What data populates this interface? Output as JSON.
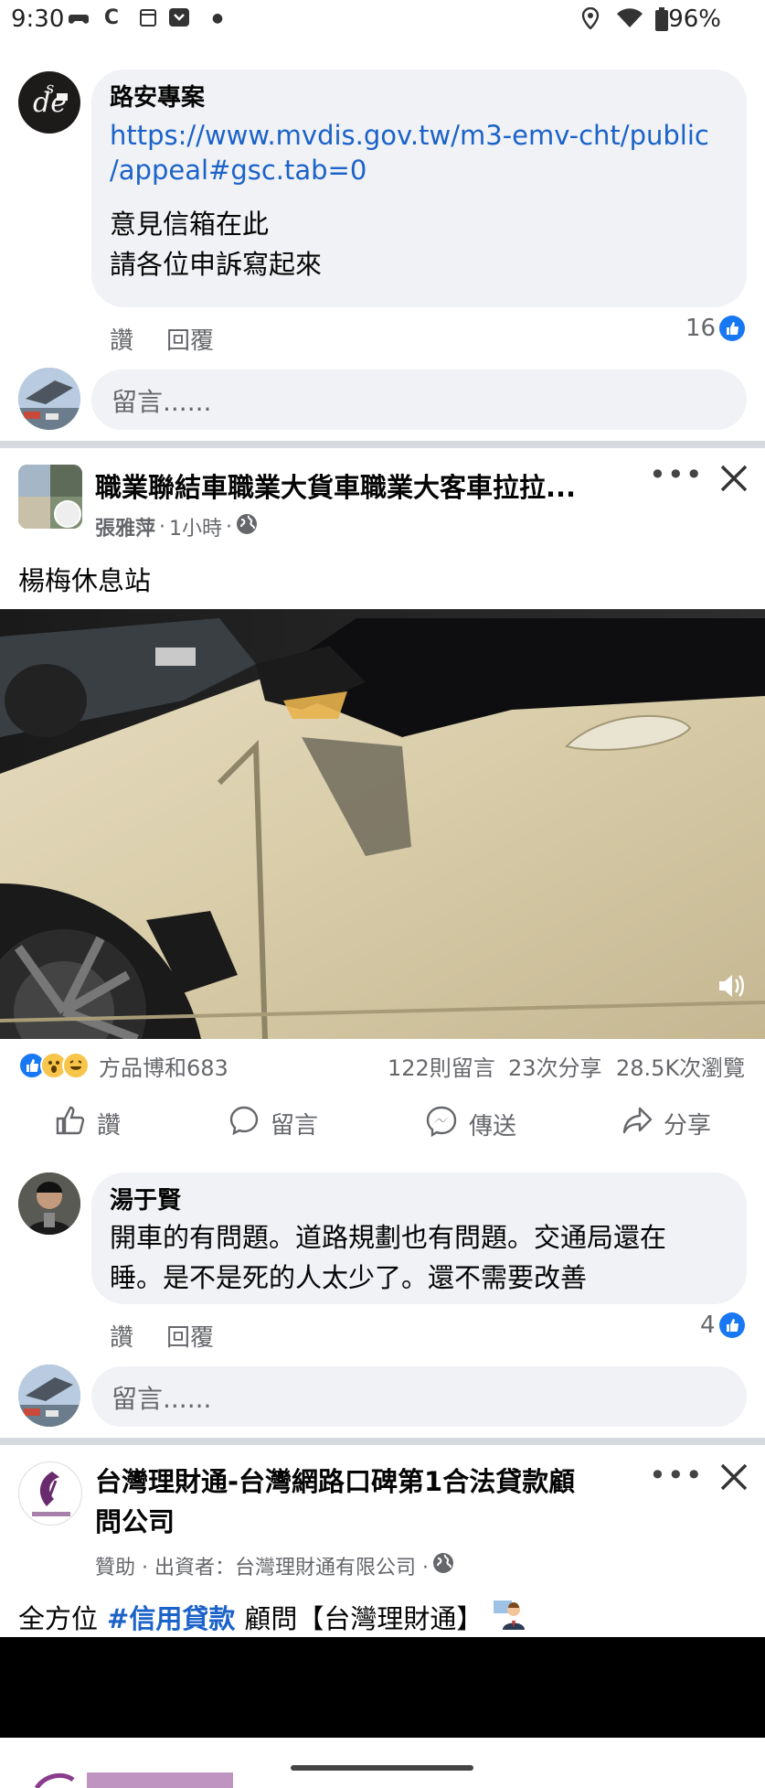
{
  "status_bar": {
    "time": "9:30",
    "battery": "96%"
  },
  "comment1": {
    "author": "路安專案",
    "link": "https://www.mvdis.gov.tw/m3-emv-cht/public/appeal#gsc.tab=0",
    "link_line1": "https://www.mvdis.gov.tw/m3-emv-cht/public",
    "link_line2": "/appeal#gsc.tab=0",
    "line1": "意見信箱在此",
    "line2": "請各位申訴寫起來",
    "like_label": "讚",
    "reply_label": "回覆",
    "like_count": "16"
  },
  "comment_input1": {
    "placeholder": "留言......"
  },
  "post1": {
    "page_name": "職業聯結車職業大貨車職業大客車拉拉...",
    "author": "張雅萍",
    "time": "1小時",
    "text": "楊梅休息站",
    "reactors": "方品博和683",
    "comments": "122則留言",
    "shares": "23次分享",
    "views": "28.5K次瀏覽",
    "buttons": {
      "like": "讚",
      "comment": "留言",
      "send": "傳送",
      "share": "分享"
    }
  },
  "comment2": {
    "author": "湯于賢",
    "line1": "開車的有問題。道路規劃也有問題。交通局還在",
    "line2": "睡。是不是死的人太少了。還不需要改善",
    "like_label": "讚",
    "reply_label": "回覆",
    "like_count": "4"
  },
  "comment_input2": {
    "placeholder": "留言......"
  },
  "ad": {
    "title_line1": "台灣理財通-台灣網路口碑第1合法貸款顧",
    "title_line2": "問公司",
    "meta": "贊助 · 出資者：台灣理財通有限公司 ·",
    "text_prefix": "全方位",
    "hashtag": "#信用貸款",
    "text_suffix": "顧問【台灣理財通】"
  },
  "colors": {
    "link": "#1b62c9",
    "like_blue": "#1877f2",
    "bubble_bg": "#f0f2f5",
    "secondary_text": "#65676b"
  },
  "icons": {
    "more": "more-horizontal-icon",
    "close": "close-icon",
    "globe": "globe-icon",
    "volume": "volume-icon"
  }
}
